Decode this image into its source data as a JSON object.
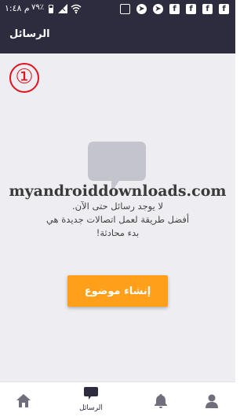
{
  "status_bar": {
    "time": "م ١:٤٨",
    "battery": "٧٩٪"
  },
  "app_bar": {
    "title": "الرسائل"
  },
  "annotation": {
    "step_number": "①"
  },
  "empty_state": {
    "watermark": "myandroiddownloads.com",
    "line1": "لا يوجد رسائل حتى الآن.",
    "line2": "أفضل طريقة لعمل اتصالات جديدة هي",
    "line3": "بدء محادثة!",
    "create_button_label": "إنشاء موضوع"
  },
  "bottom_nav": {
    "items": [
      {
        "icon": "home-icon",
        "label": ""
      },
      {
        "icon": "chat-bubble-icon",
        "label": "الرسائل",
        "active": true
      },
      {
        "icon": "bell-icon",
        "label": ""
      },
      {
        "icon": "profile-icon",
        "label": ""
      }
    ]
  },
  "colors": {
    "app_bar": "#2d2c3f",
    "background": "#ededf2",
    "accent": "#ff9f1a",
    "annotation": "#e3131b"
  }
}
